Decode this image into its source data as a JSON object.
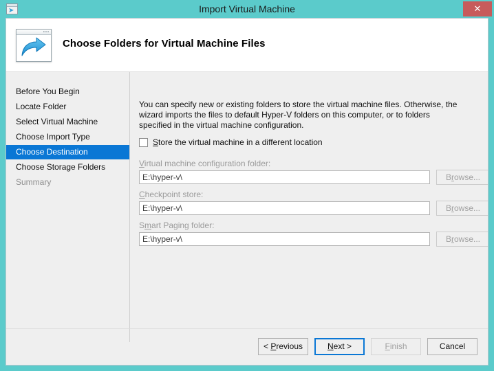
{
  "window": {
    "title": "Import Virtual Machine",
    "icon": "import-vm-window-icon",
    "close_label": "✕",
    "accent_titlebar": "#5bcbcb",
    "accent_close": "#c75b5b",
    "accent_selection": "#0a77d5"
  },
  "header": {
    "title": "Choose Folders for Virtual Machine Files",
    "icon": "export-arrow-window-icon"
  },
  "sidebar": {
    "items": [
      {
        "label": "Before You Begin",
        "state": "normal"
      },
      {
        "label": "Locate Folder",
        "state": "normal"
      },
      {
        "label": "Select Virtual Machine",
        "state": "normal"
      },
      {
        "label": "Choose Import Type",
        "state": "normal"
      },
      {
        "label": "Choose Destination",
        "state": "selected"
      },
      {
        "label": "Choose Storage Folders",
        "state": "normal"
      },
      {
        "label": "Summary",
        "state": "disabled"
      }
    ]
  },
  "content": {
    "intro": "You can specify new or existing folders to store the virtual machine files. Otherwise, the wizard imports the files to default Hyper-V folders on this computer, or to folders specified in the virtual machine configuration.",
    "checkbox": {
      "label_before": "",
      "accel": "S",
      "label_after": "tore the virtual machine in a different location",
      "checked": false
    },
    "fields": [
      {
        "label_before": "",
        "accel": "V",
        "label_after": "irtual machine configuration folder:",
        "value": "E:\\hyper-v\\",
        "browse_before": "B",
        "browse_accel": "r",
        "browse_after": "owse...",
        "disabled": true
      },
      {
        "label_before": "",
        "accel": "C",
        "label_after": "heckpoint store:",
        "value": "E:\\hyper-v\\",
        "browse_before": "B",
        "browse_accel": "r",
        "browse_after": "owse...",
        "disabled": true
      },
      {
        "label_before": "S",
        "accel": "m",
        "label_after": "art Paging folder:",
        "value": "E:\\hyper-v\\",
        "browse_before": "B",
        "browse_accel": "r",
        "browse_after": "owse...",
        "disabled": true
      }
    ]
  },
  "footer": {
    "previous": {
      "before": "< ",
      "accel": "P",
      "after": "revious",
      "state": "normal"
    },
    "next": {
      "before": "",
      "accel": "N",
      "after": "ext >",
      "state": "focused"
    },
    "finish": {
      "before": "",
      "accel": "F",
      "after": "inish",
      "state": "disabled"
    },
    "cancel": {
      "before": "",
      "accel": "",
      "after": "Cancel",
      "state": "normal"
    }
  }
}
